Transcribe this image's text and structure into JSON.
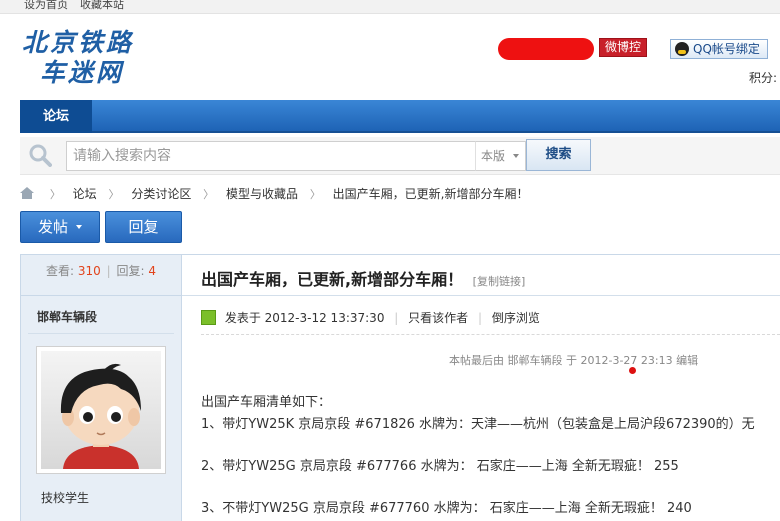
{
  "topbar": {
    "set_home": "设为首页",
    "bookmark": "收藏本站"
  },
  "logo": {
    "line1": "北京铁路",
    "line2": "车迷网"
  },
  "header": {
    "weibo_button": "微博控",
    "qq_button": "QQ帐号绑定",
    "points_label": "积分:"
  },
  "nav": {
    "forum_tab": "论坛"
  },
  "search": {
    "placeholder": "请输入搜索内容",
    "scope": "本版",
    "button": "搜索"
  },
  "breadcrumb": [
    "论坛",
    "分类讨论区",
    "模型与收藏品",
    "出国产车厢，已更新,新增部分车厢！"
  ],
  "actions": {
    "post": "发帖",
    "reply": "回复"
  },
  "thread": {
    "views_label": "查看:",
    "views": "310",
    "replies_label": "回复:",
    "replies": "4",
    "title": "出国产车厢，已更新,新增部分车厢！",
    "copy_link": "[复制链接]"
  },
  "post": {
    "author": "邯郸车辆段",
    "rank": "技校学生",
    "posted": "发表于 2012-3-12 13:37:30",
    "only_author": "只看该作者",
    "reverse_order": "倒序浏览",
    "edit_note": "本帖最后由 邯郸车辆段 于 2012-3-27 23:13 编辑",
    "lines": [
      "出国产车厢清单如下：",
      "1、带灯YW25K  京局京段 #671826  水牌为：天津——杭州（包装盒是上局沪段672390的）无",
      "2、带灯YW25G  京局京段  #677766  水牌为： 石家庄——上海  全新无瑕疵！     255",
      "3、不带灯YW25G  京局京段  #677760  水牌为： 石家庄——上海  全新无瑕疵！   240"
    ]
  }
}
